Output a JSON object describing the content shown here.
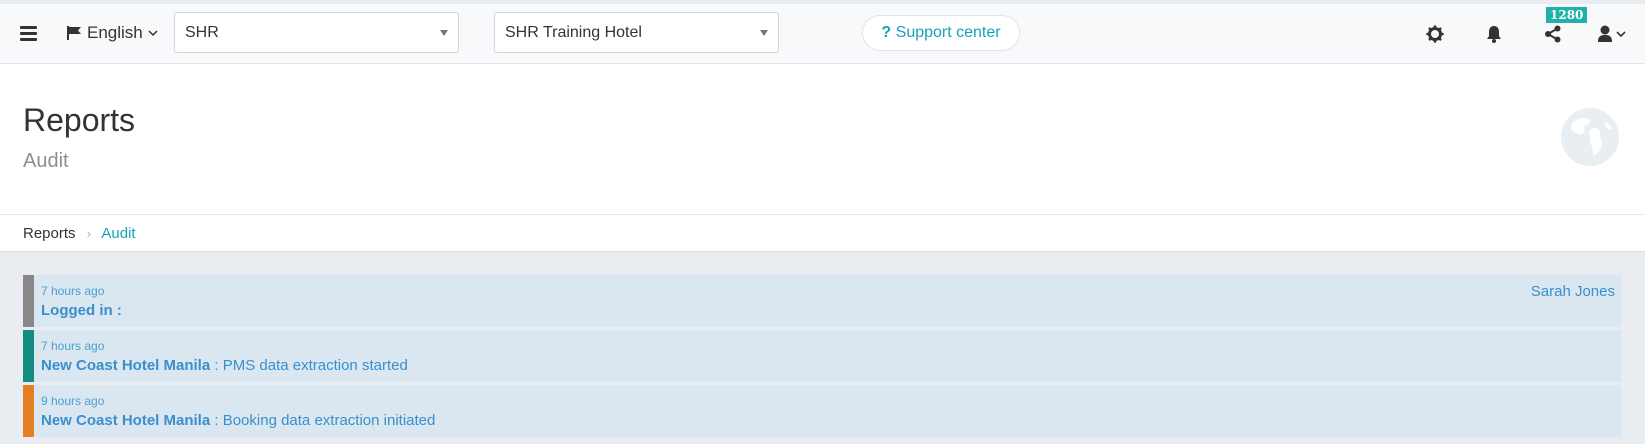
{
  "topbar": {
    "language": "English",
    "group_select": "SHR",
    "hotel_select": "SHR Training Hotel",
    "support_label": "Support center",
    "notification_count": "1280"
  },
  "header": {
    "title": "Reports",
    "subtitle": "Audit"
  },
  "breadcrumb": {
    "items": [
      "Reports",
      "Audit"
    ]
  },
  "feed": [
    {
      "time": "7 hours ago",
      "hotel": "Logged in :",
      "message": "",
      "user": "Sarah Jones",
      "color": "#888888"
    },
    {
      "time": "7 hours ago",
      "hotel": "New Coast Hotel Manila",
      "message": " : PMS data extraction started",
      "user": "",
      "color": "#138d80"
    },
    {
      "time": "9 hours ago",
      "hotel": "New Coast Hotel Manila",
      "message": " : Booking data extraction initiated",
      "user": "",
      "color": "#e67e22"
    }
  ],
  "colors": {
    "accent": "#17a2b8",
    "badge": "#20b2aa",
    "entry_bg": "#dae7f0"
  }
}
